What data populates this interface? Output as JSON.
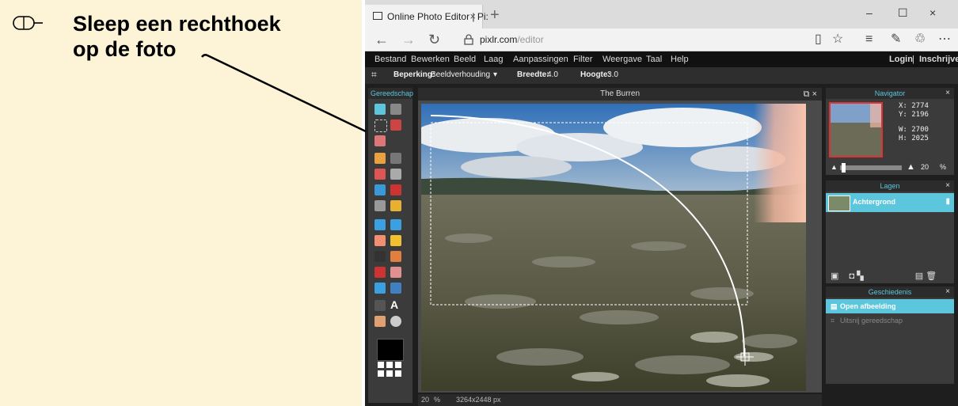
{
  "instruction": {
    "line1": "Sleep een rechthoek",
    "line2": "op de foto"
  },
  "browser": {
    "tab_title": "Online Photo Editor | Pi:",
    "tab_close": "×",
    "new_tab": "+",
    "window_controls": {
      "minimize": "–",
      "maximize": "☐",
      "close": "×"
    },
    "url_domain": "pixlr.com",
    "url_path": "/editor",
    "icons": [
      "back-icon",
      "forward-icon",
      "refresh-icon",
      "lock-icon",
      "reading-view-icon",
      "favorite-star-icon",
      "hub-icon",
      "notes-icon",
      "share-icon",
      "more-icon"
    ]
  },
  "app": {
    "menu": [
      "Bestand",
      "Bewerken",
      "Beeld",
      "Laag",
      "Aanpassingen",
      "Filter",
      "Weergave",
      "Taal",
      "Help"
    ],
    "login": "Login",
    "separator": "|",
    "signup": "Inschrijven",
    "options": {
      "constraint_label": "Beperking:",
      "constraint_value": "Beeldverhouding",
      "dropdown": "▾",
      "width_label": "Breedte:",
      "width_value": "4.0",
      "height_label": "Hoogte:",
      "height_value": "3.0"
    },
    "tools_title": "Gereedschap",
    "document_title": "The Burren",
    "navigator": {
      "title": "Navigator",
      "x_label": "X:",
      "x": "2774",
      "y_label": "Y:",
      "y": "2196",
      "w_label": "W:",
      "w": "2700",
      "h_label": "H:",
      "h": "2025",
      "zoom": "20",
      "zoom_unit": "%"
    },
    "layers": {
      "title": "Lagen",
      "layer_name": "Achtergrond"
    },
    "history": {
      "title": "Geschiedenis",
      "items": [
        "Open afbeelding",
        "Uitsnij gereedschap"
      ]
    },
    "status": {
      "zoom": "20",
      "zoom_unit": "%",
      "size": "3264x2448 px"
    }
  }
}
